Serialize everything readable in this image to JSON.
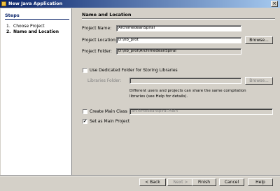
{
  "window": {
    "title": "New Java Application"
  },
  "titlebar_buttons": {
    "close": "×"
  },
  "steps": {
    "title": "Steps",
    "items": [
      {
        "num": "1.",
        "label": "Choose Project"
      },
      {
        "num": "2.",
        "label": "Name and Location"
      }
    ]
  },
  "main": {
    "section_title": "Name and Location",
    "project_name": {
      "label": "Project Name:",
      "value": "ArchimedeanSpiral"
    },
    "project_location": {
      "label": "Project Location:",
      "value": "D:\\nb_prot",
      "browse": "Browse..."
    },
    "project_folder": {
      "label": "Project Folder:",
      "value": "D:\\nb_prot\\ArchimedeanSpiral"
    },
    "dedicated_folder": {
      "label": "Use Dedicated Folder for Storing Libraries",
      "checked": false
    },
    "libraries_folder": {
      "label": "Libraries Folder:",
      "value": "",
      "browse": "Browse..."
    },
    "libraries_help": "Different users and projects can share the same compilation libraries (see Help for details).",
    "create_main_class": {
      "label": "Create Main Class",
      "value": "archimedeanspiral.Main",
      "checked": false
    },
    "set_main_project": {
      "label": "Set as Main Project",
      "checked": true,
      "mark": "✔"
    }
  },
  "footer": {
    "back": "< Back",
    "next": "Next >",
    "finish": "Finish",
    "cancel": "Cancel",
    "help": "Help"
  }
}
